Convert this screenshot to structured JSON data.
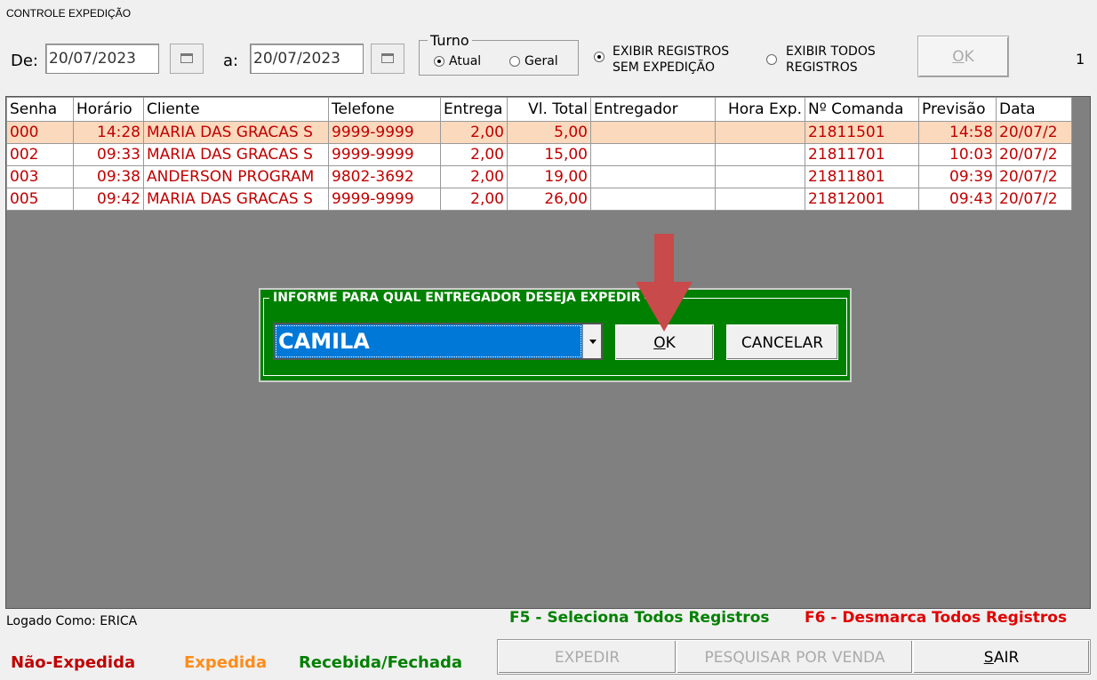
{
  "window": {
    "title": "CONTROLE EXPEDIÇÃO"
  },
  "filters": {
    "from_label": "De:",
    "from_date": "20/07/2023",
    "to_label": "a:",
    "to_date": "20/07/2023",
    "turno": {
      "legend": "Turno",
      "options": [
        "Atual",
        "Geral"
      ],
      "selected": "Atual"
    },
    "display_options": [
      {
        "line1": "EXIBIR REGISTROS",
        "line2": "SEM EXPEDIÇÃO",
        "selected": true
      },
      {
        "line1": "EXIBIR TODOS",
        "line2": "REGISTROS",
        "selected": false
      }
    ],
    "ok_label_underlined": "O",
    "ok_label_rest": "K",
    "record_count": "1"
  },
  "grid": {
    "columns": [
      "Senha",
      "Horário",
      "Cliente",
      "Telefone",
      "Entrega",
      "Vl. Total",
      "Entregador",
      "Hora Exp.",
      "Nº Comanda",
      "Previsão",
      "Data"
    ],
    "rows": [
      {
        "senha": "000",
        "horario": "14:28",
        "cliente": "MARIA DAS GRACAS S",
        "telefone": "9999-9999",
        "entrega": "2,00",
        "vl_total": "5,00",
        "entregador": "",
        "hora_exp": "",
        "comanda": "21811501",
        "previsao": "14:58",
        "data": "20/07/2"
      },
      {
        "senha": "002",
        "horario": "09:33",
        "cliente": "MARIA DAS GRACAS S",
        "telefone": "9999-9999",
        "entrega": "2,00",
        "vl_total": "15,00",
        "entregador": "",
        "hora_exp": "",
        "comanda": "21811701",
        "previsao": "10:03",
        "data": "20/07/2"
      },
      {
        "senha": "003",
        "horario": "09:38",
        "cliente": "ANDERSON PROGRAM",
        "telefone": "9802-3692",
        "entrega": "2,00",
        "vl_total": "19,00",
        "entregador": "",
        "hora_exp": "",
        "comanda": "21811801",
        "previsao": "09:39",
        "data": "20/07/2"
      },
      {
        "senha": "005",
        "horario": "09:42",
        "cliente": "MARIA DAS GRACAS S",
        "telefone": "9999-9999",
        "entrega": "2,00",
        "vl_total": "26,00",
        "entregador": "",
        "hora_exp": "",
        "comanda": "21812001",
        "previsao": "09:43",
        "data": "20/07/2"
      }
    ]
  },
  "dialog": {
    "title": "INFORME PARA QUAL ENTREGADOR DESEJA EXPEDIR",
    "selected_entregador": "CAMILA",
    "ok_underlined": "O",
    "ok_rest": "K",
    "cancel_label": "CANCELAR"
  },
  "status": {
    "logged_as": "Logado Como: ERICA",
    "f5_hint": "F5 - Seleciona Todos Registros",
    "f6_hint": "F6 - Desmarca Todos Registros"
  },
  "legend": {
    "nao_expedida": "Não-Expedida",
    "expedida": "Expedida",
    "recebida": "Recebida/Fechada"
  },
  "buttons": {
    "expedir": "EXPEDIR",
    "pesquisar": "PESQUISAR POR VENDA",
    "sair_underlined": "S",
    "sair_rest": "AIR"
  },
  "colors": {
    "nao_expedida": "#c00000",
    "expedida": "#ff8c1a",
    "recebida": "#008000",
    "f5": "#008000",
    "f6": "#e00000",
    "dialog_bg": "#008000",
    "selection": "#0078d7",
    "arrow": "#c84a4a"
  }
}
